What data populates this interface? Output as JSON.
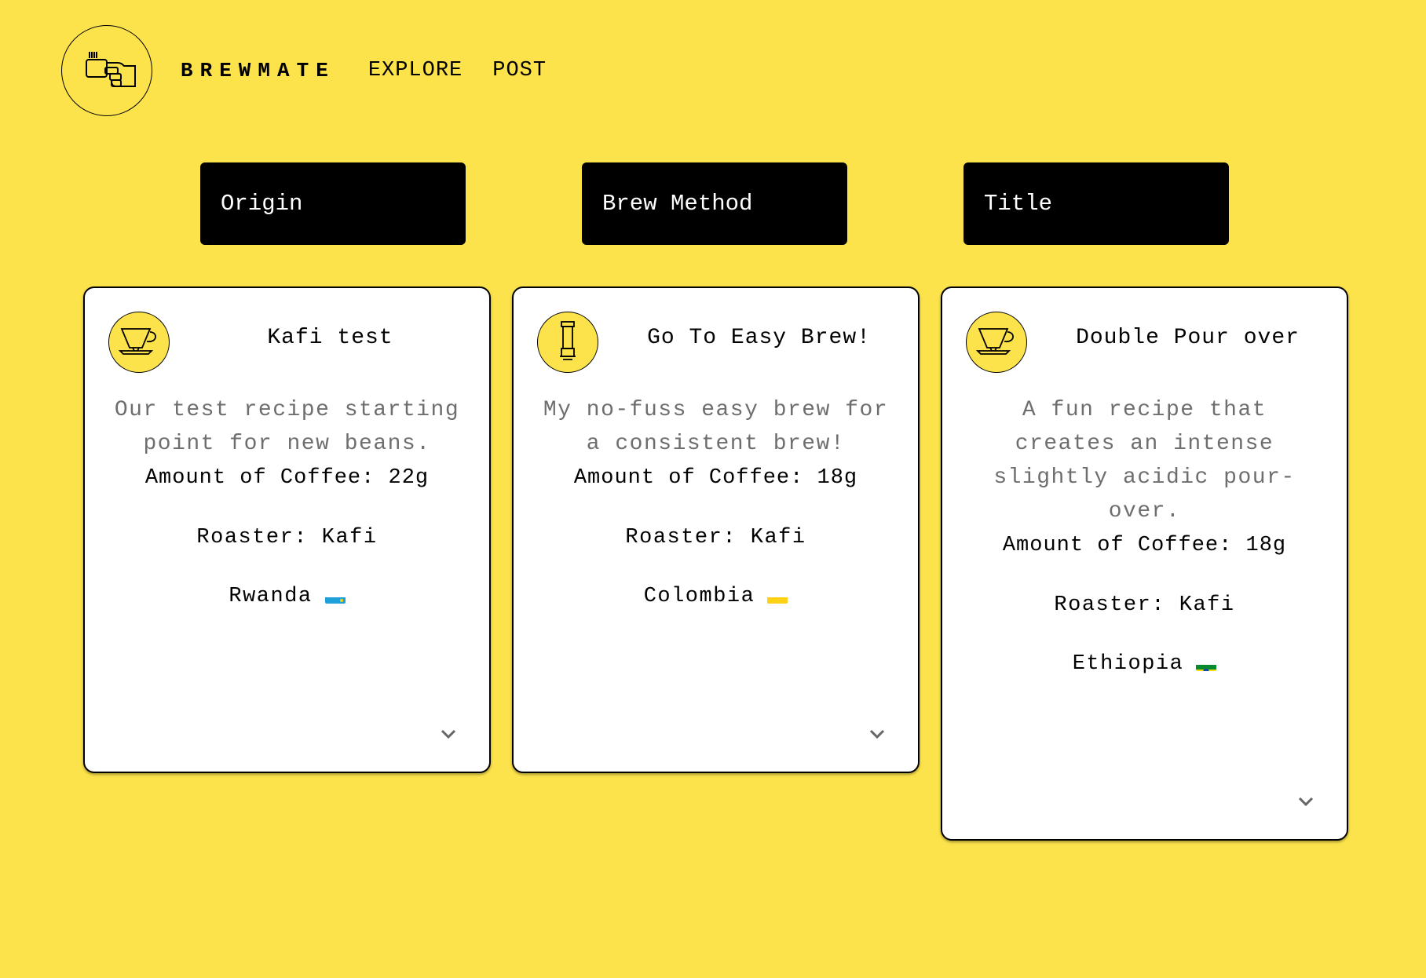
{
  "app": {
    "brand": "BREWMATE",
    "logo_icon": "coffee-cup-hand-icon"
  },
  "nav": {
    "items": [
      {
        "label": "EXPLORE"
      },
      {
        "label": "POST"
      }
    ]
  },
  "filters": [
    {
      "label": "Origin"
    },
    {
      "label": "Brew Method"
    },
    {
      "label": "Title"
    }
  ],
  "cards": [
    {
      "title": "Kafi test",
      "method_icon": "pour-over-dripper-icon",
      "description": "Our test recipe starting point for new beans.",
      "amount": "Amount of Coffee: 22g",
      "roaster": "Roaster: Kafi",
      "origin": "Rwanda",
      "flag": "rwanda-flag"
    },
    {
      "title": "Go To Easy Brew!",
      "method_icon": "aeropress-icon",
      "description": "My no-fuss easy brew for a consistent brew!",
      "amount": "Amount of Coffee: 18g",
      "roaster": "Roaster: Kafi",
      "origin": "Colombia",
      "flag": "colombia-flag"
    },
    {
      "title": "Double Pour over",
      "method_icon": "pour-over-dripper-icon",
      "description": "A fun recipe that creates an intense slightly acidic pour-over.",
      "amount": "Amount of Coffee: 18g",
      "roaster": "Roaster: Kafi",
      "origin": "Ethiopia",
      "flag": "ethiopia-flag"
    }
  ],
  "colors": {
    "background": "#fde34b",
    "filter_bg": "#000000",
    "card_bg": "#ffffff",
    "description_text": "#6e6e6e"
  }
}
